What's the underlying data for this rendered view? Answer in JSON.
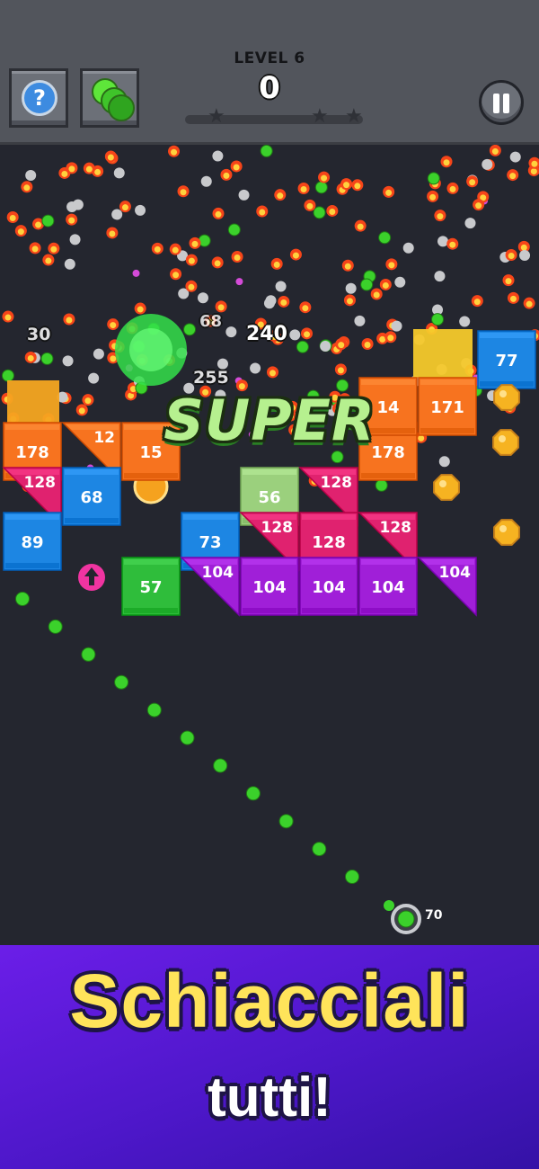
{
  "header": {
    "level_label": "LEVEL 6",
    "score": "0",
    "progress": 0.0,
    "star_count": 3,
    "help_icon": "question-mark-icon",
    "balls_icon": "green-balls-icon",
    "pause_icon": "pause-icon"
  },
  "colors": {
    "orange": "#f7731f",
    "blue": "#1d86e3",
    "magenta": "#e0226f",
    "purple": "#a01fd8",
    "green": "#2fbd3b",
    "light_green": "#9bd07d",
    "yellow": "#f6c92b",
    "ball": "#3bd12b",
    "coin": "#f6b321"
  },
  "field": {
    "bricks": [
      {
        "shape": "square",
        "label": "178",
        "color": "orange"
      },
      {
        "shape": "tri-tl",
        "label": "12",
        "color": "orange"
      },
      {
        "shape": "square",
        "label": "15",
        "color": "orange"
      },
      {
        "shape": "square",
        "label": "178",
        "color": "orange"
      },
      {
        "shape": "square",
        "label": "14",
        "color": "orange"
      },
      {
        "shape": "square",
        "label": "171",
        "color": "orange"
      },
      {
        "shape": "square",
        "label": "77",
        "color": "blue"
      },
      {
        "shape": "tri-tl",
        "label": "128",
        "color": "magenta"
      },
      {
        "shape": "square",
        "label": "68",
        "color": "blue"
      },
      {
        "shape": "square",
        "label": "56",
        "color": "light_green"
      },
      {
        "shape": "tri-tl",
        "label": "128",
        "color": "magenta"
      },
      {
        "shape": "square",
        "label": "89",
        "color": "blue"
      },
      {
        "shape": "square",
        "label": "73",
        "color": "blue"
      },
      {
        "shape": "tri-tl",
        "label": "128",
        "color": "magenta"
      },
      {
        "shape": "square",
        "label": "128",
        "color": "magenta"
      },
      {
        "shape": "tri-tl",
        "label": "128",
        "color": "magenta"
      },
      {
        "shape": "square",
        "label": "57",
        "color": "green"
      },
      {
        "shape": "tri-tl",
        "label": "104",
        "color": "purple"
      },
      {
        "shape": "square",
        "label": "104",
        "color": "purple"
      },
      {
        "shape": "square",
        "label": "104",
        "color": "purple"
      },
      {
        "shape": "square",
        "label": "104",
        "color": "purple"
      },
      {
        "shape": "tri-tl",
        "label": "104",
        "color": "purple"
      }
    ],
    "score_pops": [
      "240",
      "68",
      "255",
      "30"
    ],
    "combo_text": "SUPER",
    "launcher_count": "70"
  },
  "banner": {
    "title": "Schiacciali",
    "subtitle": "tutti!"
  }
}
